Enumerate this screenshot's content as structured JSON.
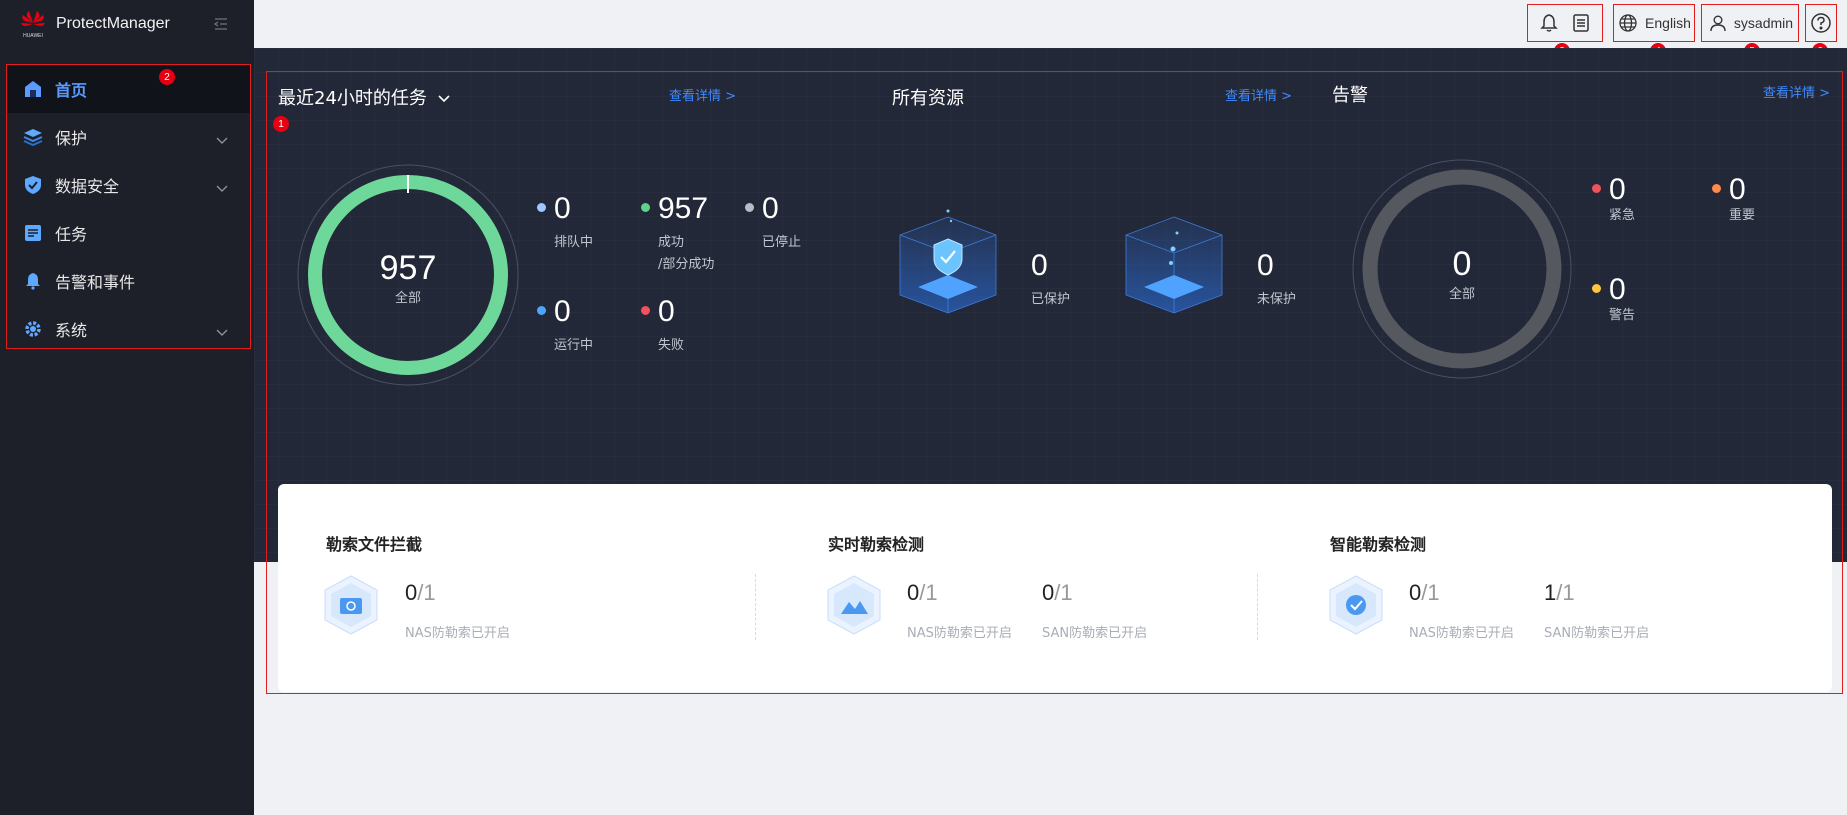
{
  "app": {
    "brand": "ProtectManager",
    "logo_text": "HUAWEI"
  },
  "sidebar": {
    "items": [
      {
        "label": "首页",
        "icon": "home-icon",
        "active": true
      },
      {
        "label": "保护",
        "icon": "layers-icon",
        "expandable": true
      },
      {
        "label": "数据安全",
        "icon": "shield-icon",
        "expandable": true
      },
      {
        "label": "任务",
        "icon": "task-list-icon"
      },
      {
        "label": "告警和事件",
        "icon": "bell-icon"
      },
      {
        "label": "系统",
        "icon": "gear-icon",
        "expandable": true
      }
    ]
  },
  "topbar": {
    "language": "English",
    "user": "sysadmin"
  },
  "badges": {
    "b1": "1",
    "b2": "2",
    "b3": "3",
    "b4": "4",
    "b5": "5",
    "b6": "6"
  },
  "tasks": {
    "title": "最近24小时的任务",
    "link": "查看详情 >",
    "total": "957",
    "total_label": "全部",
    "stats": {
      "queued": {
        "value": "0",
        "label": "排队中",
        "color": "#9ec9ff"
      },
      "success": {
        "value": "957",
        "label": "成功",
        "label2": "/部分成功",
        "color": "#5fd18a"
      },
      "stopped": {
        "value": "0",
        "label": "已停止",
        "color": "#b9bcc5"
      },
      "running": {
        "value": "0",
        "label": "运行中",
        "color": "#4aa6ff"
      },
      "failed": {
        "value": "0",
        "label": "失败",
        "color": "#f0525b"
      }
    },
    "success_ratio": 1.0
  },
  "resources": {
    "title": "所有资源",
    "link": "查看详情 >",
    "protected": {
      "value": "0",
      "label": "已保护"
    },
    "unprotected": {
      "value": "0",
      "label": "未保护"
    }
  },
  "alarms": {
    "title": "告警",
    "link": "查看详情 >",
    "total": "0",
    "total_label": "全部",
    "critical": {
      "value": "0",
      "label": "紧急",
      "color": "#f0525b"
    },
    "major": {
      "value": "0",
      "label": "重要",
      "color": "#ff8a4c"
    },
    "warning": {
      "value": "0",
      "label": "警告",
      "color": "#ffc53d"
    }
  },
  "ransomware": {
    "block": {
      "title": "勒索文件拦截",
      "nas_num": "0",
      "nas_den": "/1",
      "nas_label": "NAS防勒索已开启"
    },
    "realtime": {
      "title": "实时勒索检测",
      "nas_num": "0",
      "nas_den": "/1",
      "nas_label": "NAS防勒索已开启",
      "san_num": "0",
      "san_den": "/1",
      "san_label": "SAN防勒索已开启"
    },
    "smart": {
      "title": "智能勒索检测",
      "nas_num": "0",
      "nas_den": "/1",
      "nas_label": "NAS防勒索已开启",
      "san_num": "1",
      "san_den": "/1",
      "san_label": "SAN防勒索已开启"
    }
  }
}
